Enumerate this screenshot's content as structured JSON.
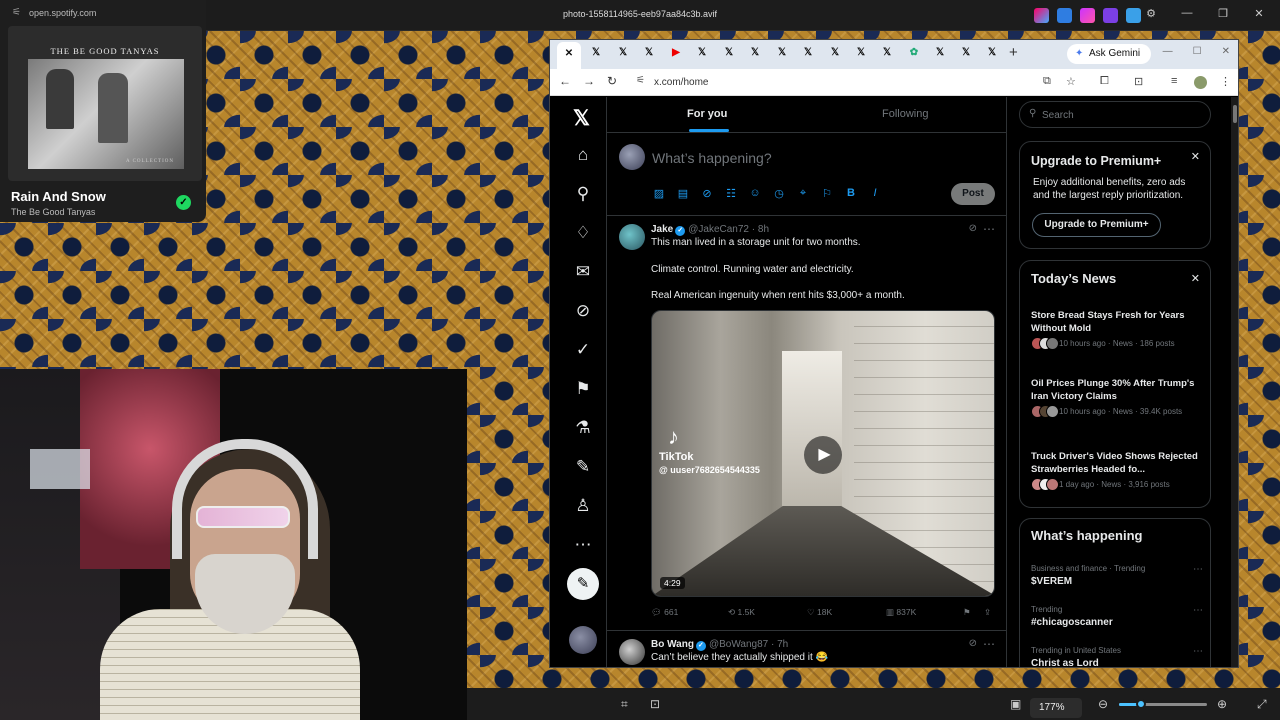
{
  "viewer": {
    "title": "photo-1558114965-eeb97aa84c3b.avif",
    "zoom": "177%",
    "zoom_level_fraction": 0.25
  },
  "spotify": {
    "url": "open.spotify.com",
    "album_title": "THE BE GOOD TANYAS",
    "album_subtitle": "A COLLECTION",
    "track": "Rain And Snow",
    "artist": "The Be Good Tanyas"
  },
  "browser": {
    "url": "x.com/home",
    "gemini_label": "Ask Gemini"
  },
  "x": {
    "tabs": {
      "for_you": "For you",
      "following": "Following"
    },
    "composer": {
      "placeholder": "What’s happening?",
      "post_label": "Post"
    },
    "tweet1": {
      "name": "Jake",
      "handle": "@JakeCan72 · 8h",
      "line1": "This man lived in a storage unit for two months.",
      "line2": "Climate control. Running water and electricity.",
      "line3": "Real American ingenuity when rent hits $3,000+ a month.",
      "video_brand": "TikTok",
      "video_user": "@ uuser7682654544335",
      "duration": "4:29",
      "replies": "661",
      "reposts": "1.5K",
      "likes": "18K",
      "views": "837K"
    },
    "tweet2": {
      "name": "Bo Wang",
      "handle": "@BoWang87 · 7h",
      "line1": "Can’t believe they actually shipped it 😂"
    },
    "search_placeholder": "Search",
    "premium": {
      "title": "Upgrade to Premium+",
      "desc": "Enjoy additional benefits, zero ads and the largest reply prioritization.",
      "button": "Upgrade to Premium+"
    },
    "news": {
      "title": "Today’s News",
      "items": [
        {
          "headline": "Store Bread Stays Fresh for Years Without Mold",
          "meta": "10 hours ago · News · 186 posts"
        },
        {
          "headline": "Oil Prices Plunge 30% After Trump's Iran Victory Claims",
          "meta": "10 hours ago · News · 39.4K posts"
        },
        {
          "headline": "Truck Driver's Video Shows Rejected Strawberries Headed fo...",
          "meta": "1 day ago · News · 3,916 posts"
        }
      ]
    },
    "happening": {
      "title": "What’s happening",
      "trends": [
        {
          "context": "Business and finance · Trending",
          "name": "$VEREM"
        },
        {
          "context": "Trending",
          "name": "#chicagoscanner"
        },
        {
          "context": "Trending in United States",
          "name": "Christ as Lord"
        }
      ]
    }
  },
  "colors": {
    "accent": "#1d9bf0",
    "spotify_green": "#1ed760",
    "background": "#000000"
  }
}
